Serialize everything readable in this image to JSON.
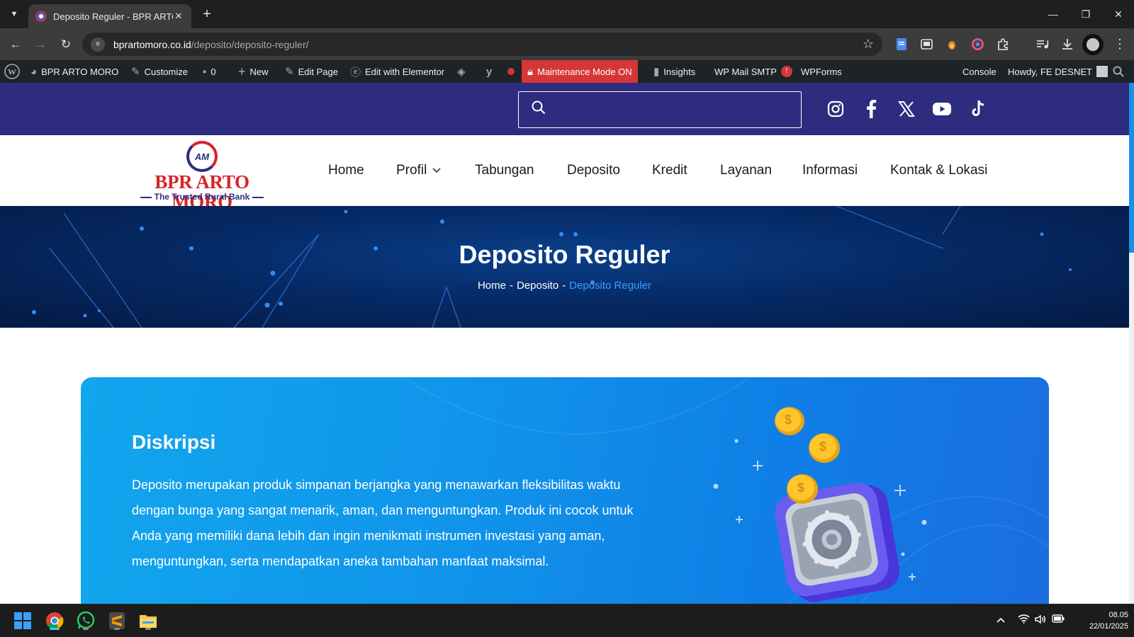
{
  "browser": {
    "tab_title": "Deposito Reguler - BPR ARTO MORO",
    "url_host": "bprartomoro.co.id",
    "url_path": "/deposito/deposito-reguler/"
  },
  "adminbar": {
    "site_name": "BPR ARTO MORO",
    "customize": "Customize",
    "comments_count": "0",
    "new": "New",
    "edit_page": "Edit Page",
    "edit_elementor": "Edit with Elementor",
    "maintenance": "Maintenance Mode ON",
    "insights": "Insights",
    "wp_mail_smtp": "WP Mail SMTP",
    "smtp_badge": "!",
    "wpforms": "WPForms",
    "console": "Console",
    "howdy": "Howdy, FE DESNET"
  },
  "site": {
    "search_placeholder": "",
    "logo_mark": "AM",
    "logo_name": "BPR ARTO MORO",
    "logo_tagline": "The Trusted Rural Bank",
    "nav": [
      "Home",
      "Profil",
      "Tabungan",
      "Deposito",
      "Kredit",
      "Layanan",
      "Informasi",
      "Kontak & Lokasi"
    ]
  },
  "hero": {
    "title": "Deposito Reguler",
    "breadcrumb": [
      "Home",
      "Deposito",
      "Deposito Reguler"
    ],
    "separator": "-"
  },
  "content": {
    "heading": "Diskripsi",
    "body": "Deposito merupakan produk simpanan berjangka yang menawarkan fleksibilitas waktu dengan bunga yang sangat menarik, aman, dan menguntungkan. Produk ini cocok untuk Anda yang memiliki dana lebih dan ingin menikmati instrumen investasi yang aman, menguntungkan, serta mendapatkan aneka tambahan manfaat maksimal."
  },
  "taskbar": {
    "time": "08.05",
    "date": "22/01/2025"
  },
  "colors": {
    "brand_navy": "#2d2c7f",
    "brand_red": "#d6242a",
    "accent_blue": "#3aa0ff",
    "card_blue": "#1094ea",
    "wp_bar": "#1d2327"
  }
}
